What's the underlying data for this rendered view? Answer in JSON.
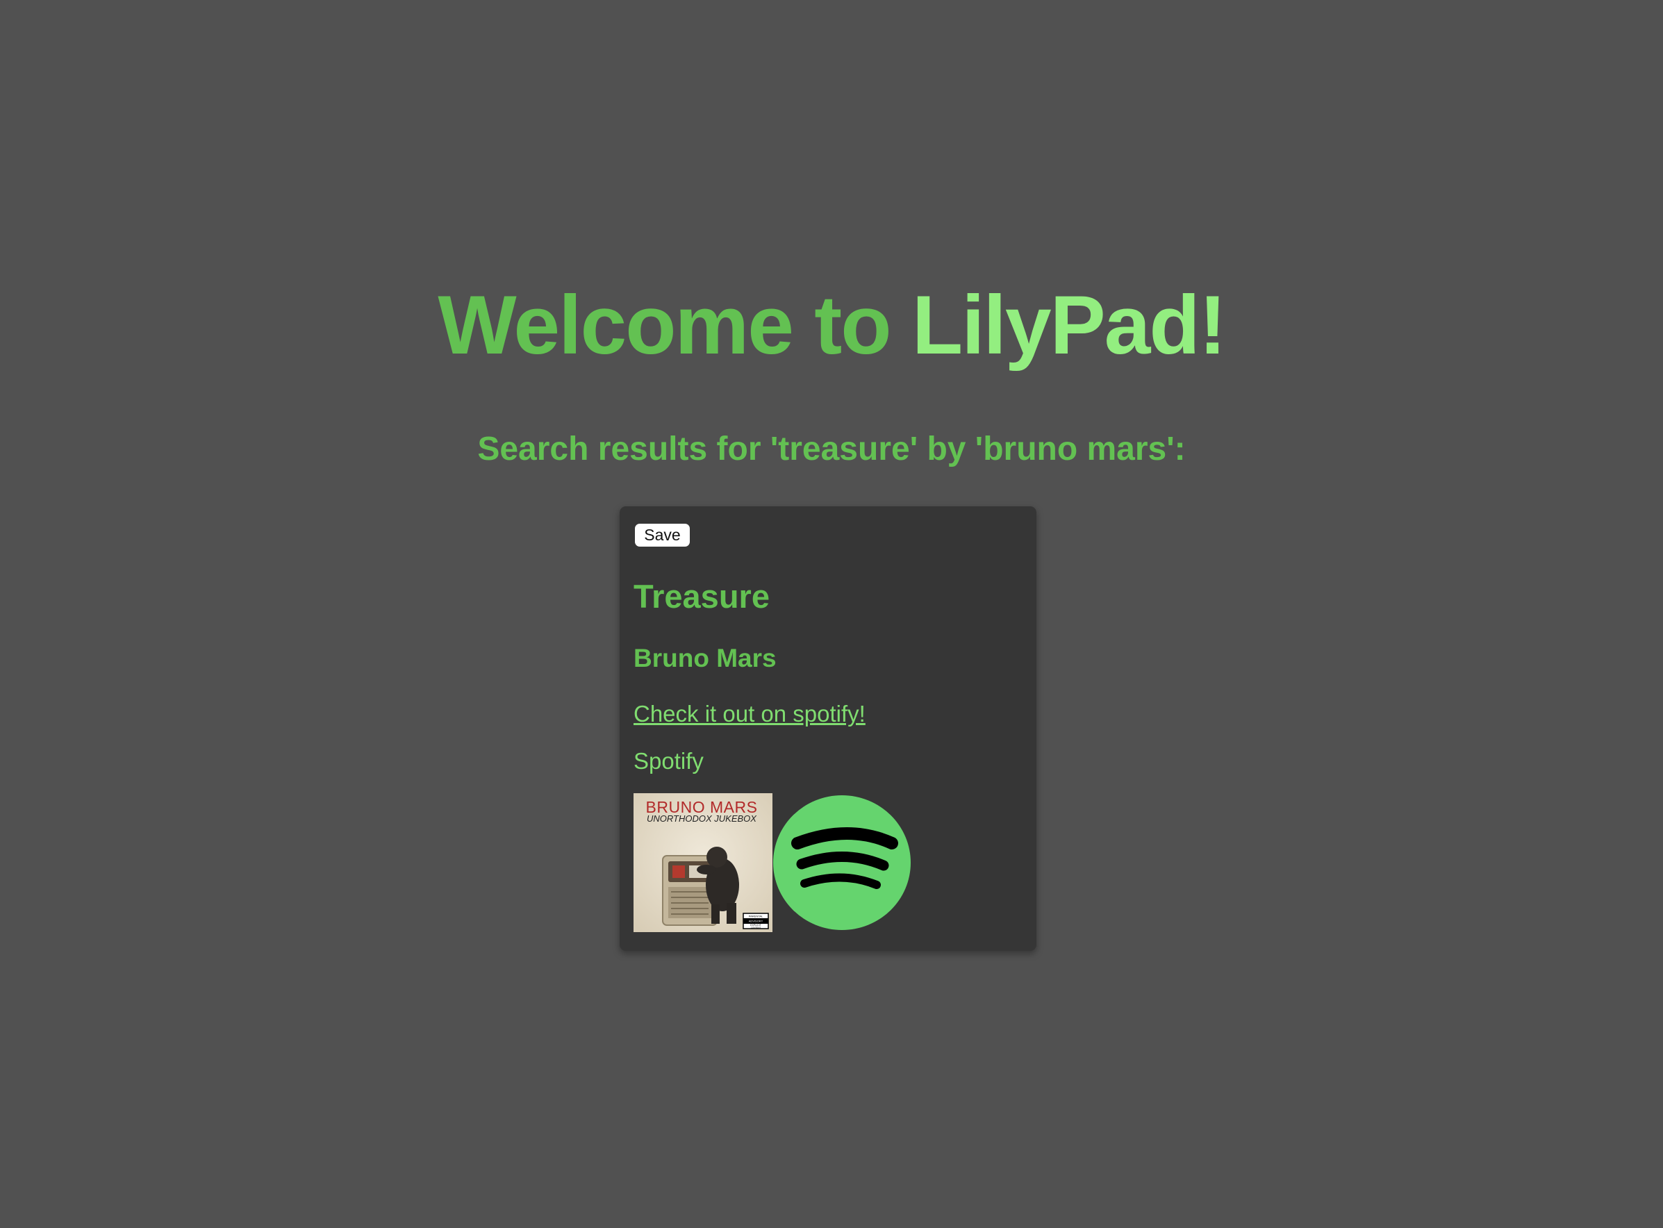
{
  "header": {
    "title_part1": "Welcome to",
    "title_part2": "LilyPad!",
    "subtitle": "Search results for 'treasure' by 'bruno mars':"
  },
  "result": {
    "save_label": "Save",
    "track_title": "Treasure",
    "artist": "Bruno Mars",
    "link_text": "Check it out on spotify!",
    "platform": "Spotify",
    "album_art": {
      "artist_text": "BRUNO MARS",
      "album_text": "UNORTHODOX JUKEBOX",
      "advisory_lines": [
        "PARENTAL",
        "ADVISORY",
        "EXPLICIT",
        "CONTENT"
      ]
    },
    "logo_icon": "spotify-logo-icon"
  },
  "colors": {
    "background": "#515151",
    "card": "#363636",
    "accent": "#63c152",
    "accent_light": "#93ee80",
    "spotify_green": "#65d46e"
  }
}
